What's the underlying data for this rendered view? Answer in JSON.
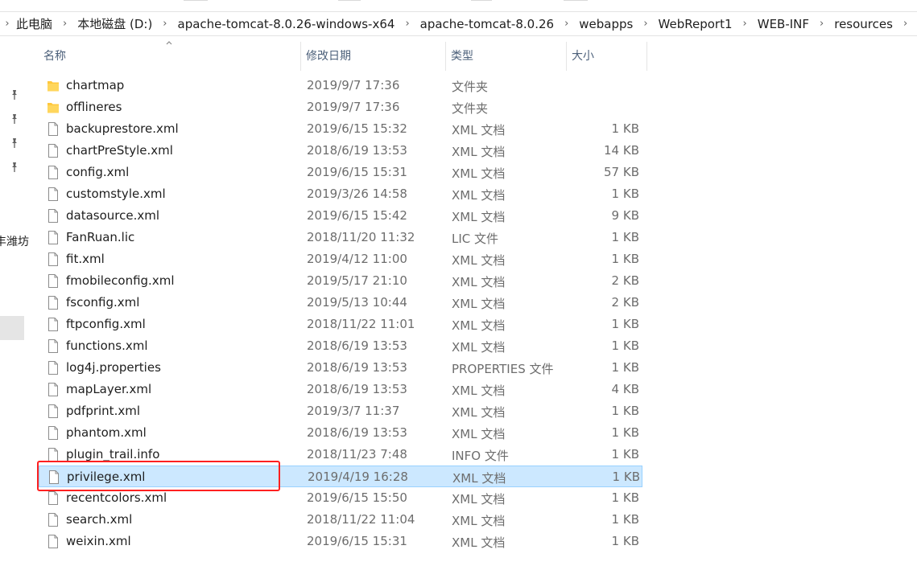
{
  "breadcrumb": [
    "此电脑",
    "本地磁盘 (D:)",
    "apache-tomcat-8.0.26-windows-x64",
    "apache-tomcat-8.0.26",
    "webapps",
    "WebReport1",
    "WEB-INF",
    "resources"
  ],
  "left_pane": {
    "partial_text": "丰潍坊"
  },
  "columns": {
    "name": "名称",
    "date": "修改日期",
    "type": "类型",
    "size": "大小"
  },
  "files": [
    {
      "name": "chartmap",
      "date": "2019/9/7 17:36",
      "type": "文件夹",
      "size": "",
      "kind": "folder"
    },
    {
      "name": "offlineres",
      "date": "2019/9/7 17:36",
      "type": "文件夹",
      "size": "",
      "kind": "folder"
    },
    {
      "name": "backuprestore.xml",
      "date": "2019/6/15 15:32",
      "type": "XML 文档",
      "size": "1 KB",
      "kind": "file"
    },
    {
      "name": "chartPreStyle.xml",
      "date": "2018/6/19 13:53",
      "type": "XML 文档",
      "size": "14 KB",
      "kind": "file"
    },
    {
      "name": "config.xml",
      "date": "2019/6/15 15:31",
      "type": "XML 文档",
      "size": "57 KB",
      "kind": "file"
    },
    {
      "name": "customstyle.xml",
      "date": "2019/3/26 14:58",
      "type": "XML 文档",
      "size": "1 KB",
      "kind": "file"
    },
    {
      "name": "datasource.xml",
      "date": "2019/6/15 15:42",
      "type": "XML 文档",
      "size": "9 KB",
      "kind": "file"
    },
    {
      "name": "FanRuan.lic",
      "date": "2018/11/20 11:32",
      "type": "LIC 文件",
      "size": "1 KB",
      "kind": "file"
    },
    {
      "name": "fit.xml",
      "date": "2019/4/12 11:00",
      "type": "XML 文档",
      "size": "1 KB",
      "kind": "file"
    },
    {
      "name": "fmobileconfig.xml",
      "date": "2019/5/17 21:10",
      "type": "XML 文档",
      "size": "2 KB",
      "kind": "file"
    },
    {
      "name": "fsconfig.xml",
      "date": "2019/5/13 10:44",
      "type": "XML 文档",
      "size": "2 KB",
      "kind": "file"
    },
    {
      "name": "ftpconfig.xml",
      "date": "2018/11/22 11:01",
      "type": "XML 文档",
      "size": "1 KB",
      "kind": "file"
    },
    {
      "name": "functions.xml",
      "date": "2018/6/19 13:53",
      "type": "XML 文档",
      "size": "1 KB",
      "kind": "file"
    },
    {
      "name": "log4j.properties",
      "date": "2018/6/19 13:53",
      "type": "PROPERTIES 文件",
      "size": "1 KB",
      "kind": "file"
    },
    {
      "name": "mapLayer.xml",
      "date": "2018/6/19 13:53",
      "type": "XML 文档",
      "size": "4 KB",
      "kind": "file"
    },
    {
      "name": "pdfprint.xml",
      "date": "2019/3/7 11:37",
      "type": "XML 文档",
      "size": "1 KB",
      "kind": "file"
    },
    {
      "name": "phantom.xml",
      "date": "2018/6/19 13:53",
      "type": "XML 文档",
      "size": "1 KB",
      "kind": "file"
    },
    {
      "name": "plugin_trail.info",
      "date": "2018/11/23 7:48",
      "type": "INFO 文件",
      "size": "1 KB",
      "kind": "file"
    },
    {
      "name": "privilege.xml",
      "date": "2019/4/19 16:28",
      "type": "XML 文档",
      "size": "1 KB",
      "kind": "file",
      "selected": true
    },
    {
      "name": "recentcolors.xml",
      "date": "2019/6/15 15:50",
      "type": "XML 文档",
      "size": "1 KB",
      "kind": "file"
    },
    {
      "name": "search.xml",
      "date": "2018/11/22 11:04",
      "type": "XML 文档",
      "size": "1 KB",
      "kind": "file"
    },
    {
      "name": "weixin.xml",
      "date": "2019/6/15 15:31",
      "type": "XML 文档",
      "size": "1 KB",
      "kind": "file"
    }
  ],
  "colors": {
    "selection_bg": "#cce8ff",
    "selection_border": "#99d1ff",
    "folder": "#ffc83d",
    "highlight": "#ff2020"
  },
  "icons": {
    "folder": "folder-icon",
    "file": "document-icon",
    "pin": "pin-icon"
  }
}
